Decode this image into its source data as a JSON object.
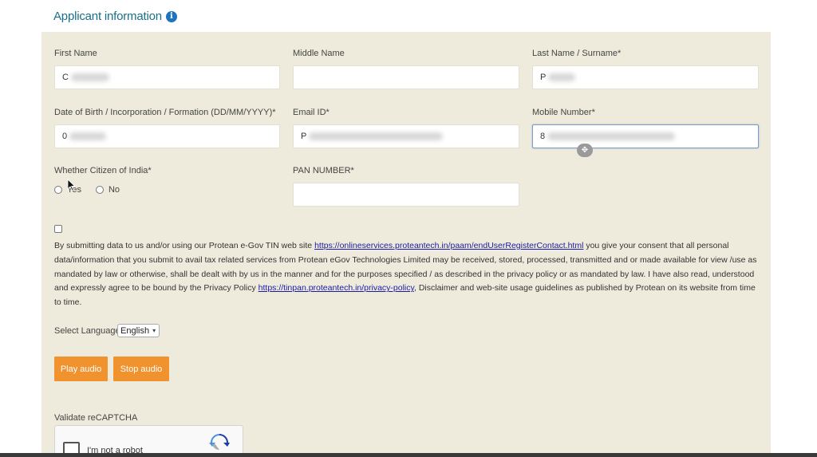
{
  "section": {
    "title": "Applicant information",
    "info_icon": "i"
  },
  "fields": {
    "first_name": {
      "label": "First Name",
      "value": "C"
    },
    "middle_name": {
      "label": "Middle Name",
      "value": ""
    },
    "last_name": {
      "label": "Last Name / Surname*",
      "value": "P"
    },
    "dob": {
      "label": "Date of Birth / Incorporation / Formation (DD/MM/YYYY)*",
      "value": "0"
    },
    "email": {
      "label": "Email ID*",
      "value": "P"
    },
    "mobile": {
      "label": "Mobile Number*",
      "value": "8"
    },
    "citizen": {
      "label": "Whether Citizen of India*",
      "options": [
        "Yes",
        "No"
      ]
    },
    "pan": {
      "label": "PAN NUMBER*",
      "value": ""
    }
  },
  "consent": {
    "text_1": "By submitting data to us and/or using our Protean e-Gov TIN web site ",
    "link_1": "https://onlineservices.proteantech.in/paam/endUserRegisterContact.html",
    "text_2": " you give your consent that all personal data/information that you submit to avail tax related services from Protean eGov Technologies Limited may be received, stored, processed, transmitted and or made available for view /use as mandated by law or otherwise, shall be dealt with by us in the manner and for the purposes specified / as described in the privacy policy or as mandated by law. I have also read, understood and expressly agree to be bound by the Privacy Policy ",
    "link_2": "https://tinpan.proteantech.in/privacy-policy",
    "text_3": ", Disclaimer and web-site usage guidelines as published by Protean on its website from time to time."
  },
  "language": {
    "label": "Select Language",
    "selected": "English"
  },
  "buttons": {
    "play": "Play audio",
    "stop": "Stop audio"
  },
  "captcha": {
    "label": "Validate reCAPTCHA",
    "text": "I'm not a robot"
  },
  "colors": {
    "accent": "#f0922e",
    "panel": "#eeebdc",
    "title": "#1a6f8a",
    "link": "#1a1aa6"
  }
}
